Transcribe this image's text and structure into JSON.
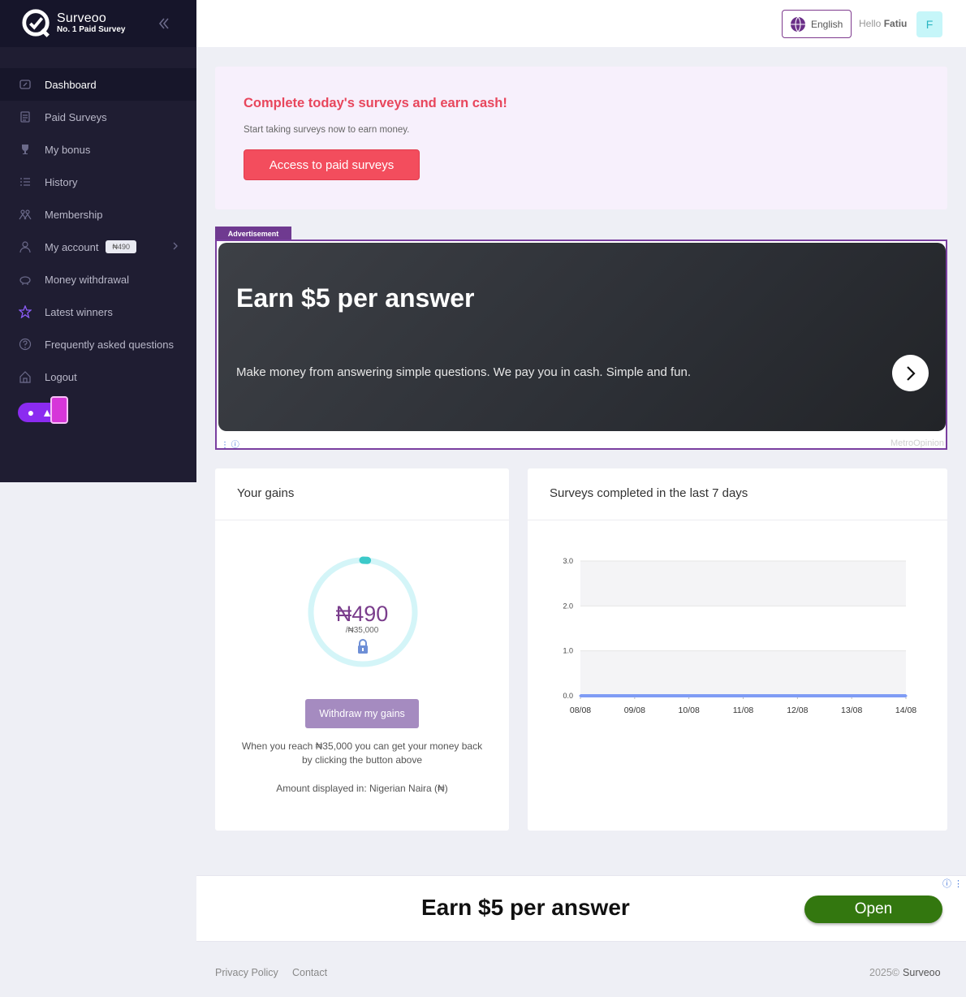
{
  "brand": {
    "name": "Surveoo",
    "tagline": "No. 1 Paid Survey"
  },
  "sidebar": {
    "items": [
      {
        "label": "Dashboard",
        "icon": "dashboard-icon"
      },
      {
        "label": "Paid Surveys",
        "icon": "clipboard-icon"
      },
      {
        "label": "My bonus",
        "icon": "trophy-icon"
      },
      {
        "label": "History",
        "icon": "list-icon"
      },
      {
        "label": "Membership",
        "icon": "users-icon"
      },
      {
        "label": "My account",
        "icon": "user-icon",
        "badge": "₦490"
      },
      {
        "label": "Money withdrawal",
        "icon": "piggy-bank-icon"
      },
      {
        "label": "Latest winners",
        "icon": "star-icon"
      },
      {
        "label": "Frequently asked questions",
        "icon": "question-icon"
      },
      {
        "label": "Logout",
        "icon": "home-icon"
      }
    ]
  },
  "topbar": {
    "language": "English",
    "hello": "Hello",
    "user": "Fatiu",
    "avatar_initial": "F"
  },
  "promo": {
    "title": "Complete today's surveys and earn cash!",
    "subtitle": "Start taking surveys now to earn money.",
    "button": "Access to paid surveys"
  },
  "ad": {
    "label": "Advertisement",
    "headline": "Earn $5 per answer",
    "text": "Make money from answering simple questions. We pay you in cash. Simple and fun.",
    "brand": "MetroOpinion"
  },
  "gains": {
    "title": "Your gains",
    "amount": "₦490",
    "goal": "/₦35,000",
    "progress_fraction": 0.014,
    "button": "Withdraw my gains",
    "note": "When you reach ₦35,000 you can get your money back by clicking the button above",
    "currency": "Amount displayed in: Nigerian Naira (₦)"
  },
  "chart_data": {
    "type": "line",
    "title": "Surveys completed in the last 7 days",
    "x": [
      "08/08",
      "09/08",
      "10/08",
      "11/08",
      "12/08",
      "13/08",
      "14/08"
    ],
    "series": [
      {
        "values": [
          0,
          0,
          0,
          0,
          0,
          0,
          0
        ]
      }
    ],
    "yticks": [
      "3.0",
      "2.0",
      "1.0",
      "0.0"
    ],
    "ylim": [
      0,
      3
    ],
    "grid": true,
    "color": "#7f9cf5"
  },
  "bottom_ad": {
    "headline": "Earn $5 per answer",
    "button": "Open"
  },
  "footer": {
    "privacy": "Privacy Policy",
    "contact": "Contact",
    "copyright": "2025©",
    "brand": "Surveoo"
  },
  "colors": {
    "sidebar": "#1f1d32",
    "accent": "#f34d5d",
    "purple": "#7a3d8c",
    "teal": "#2bb6c2"
  }
}
